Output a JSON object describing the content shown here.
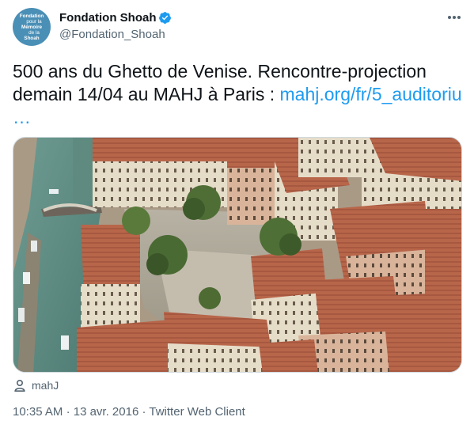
{
  "author": {
    "avatar_lines": [
      "Fondation",
      "pour la",
      "Mémoire",
      "de la",
      "Shoah"
    ],
    "display_name": "Fondation Shoah",
    "handle": "@Fondation_Shoah"
  },
  "tweet": {
    "text_line1": "500 ans du Ghetto de Venise. Rencontre-projection",
    "text_line2_prefix": "demain 14/04 au MAHJ à Paris : ",
    "link_text": "mahj.org/fr/5_auditoriu",
    "ellipsis": "…",
    "media_source": "mahJ",
    "time": "10:35 AM",
    "separator": "·",
    "date": "13 avr. 2016",
    "client": "Twitter Web Client"
  },
  "colors": {
    "link": "#1d9bf0",
    "verified": "#1d9bf0",
    "secondary_text": "#536471",
    "avatar_bg": "#4a8fb6"
  },
  "icons": {
    "verified": "verified-badge-icon",
    "more": "more-dots-icon",
    "source": "person-icon"
  }
}
